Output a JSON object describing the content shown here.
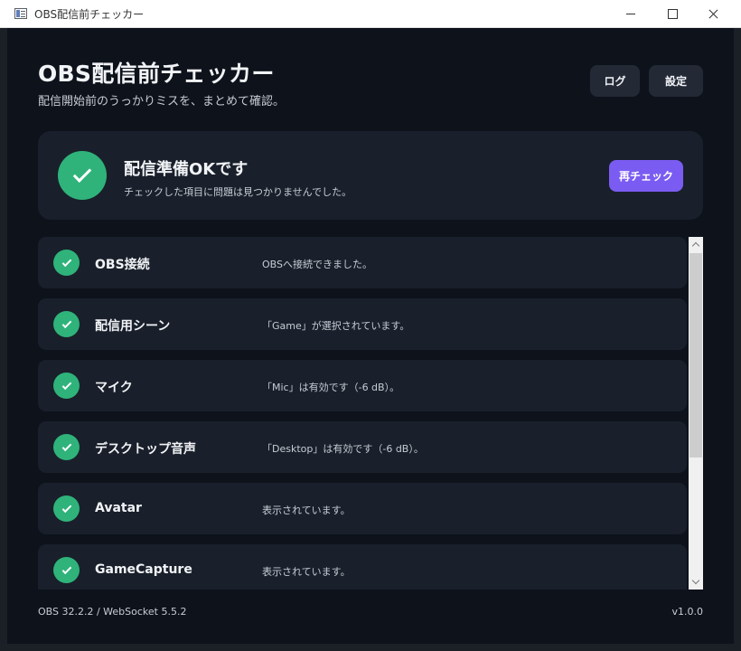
{
  "window": {
    "title": "OBS配信前チェッカー"
  },
  "header": {
    "title": "OBS配信前チェッカー",
    "subtitle": "配信開始前のうっかりミスを、まとめて確認。",
    "log_label": "ログ",
    "settings_label": "設定"
  },
  "status": {
    "title": "配信準備OKです",
    "message": "チェックした項目に問題は見つかりませんでした。",
    "recheck_label": "再チェック",
    "icon": "check-circle-icon"
  },
  "checks": [
    {
      "name": "OBS接続",
      "message": "OBSへ接続できました。",
      "status": "ok"
    },
    {
      "name": "配信用シーン",
      "message": "「Game」が選択されています。",
      "status": "ok"
    },
    {
      "name": "マイク",
      "message": "「Mic」は有効です（-6 dB）。",
      "status": "ok"
    },
    {
      "name": "デスクトップ音声",
      "message": "「Desktop」は有効です（-6 dB）。",
      "status": "ok"
    },
    {
      "name": "Avatar",
      "message": "表示されています。",
      "status": "ok"
    },
    {
      "name": "GameCapture",
      "message": "表示されています。",
      "status": "ok"
    }
  ],
  "footer": {
    "versions": "OBS 32.2.2 / WebSocket 5.5.2",
    "app_version": "v1.0.0"
  },
  "colors": {
    "background": "#0d121b",
    "card": "#19202b",
    "ok_green": "#2fb37a",
    "accent": "#7b5cf2"
  }
}
